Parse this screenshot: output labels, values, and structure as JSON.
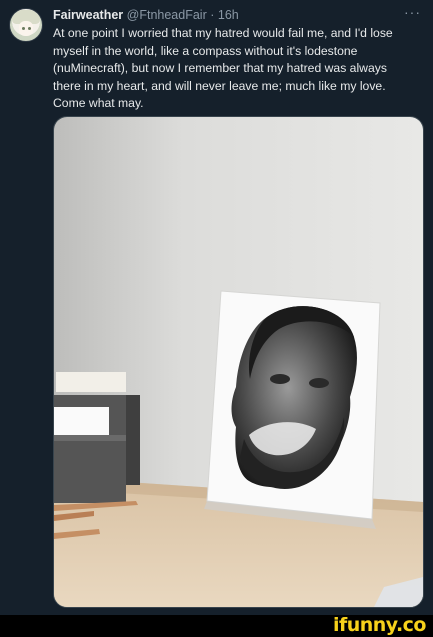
{
  "tweet": {
    "display_name": "Fairweather",
    "handle": "@FtnheadFair",
    "separator": "·",
    "time": "16h",
    "more_glyph": "···",
    "text": "At one point I worried that my hatred would fail me, and I'd lose myself in the world, like a compass without it's lodestone (nuMinecraft), but now I remember that my hatred was always there in my heart, and will never leave me; much like my love. Come what may."
  },
  "watermark": {
    "text": "ifunny.co",
    "color": "#f7d21b"
  },
  "colors": {
    "background": "#15202b",
    "text_primary": "#e7e9ea",
    "text_secondary": "#8b98a5",
    "border": "#38444d"
  }
}
